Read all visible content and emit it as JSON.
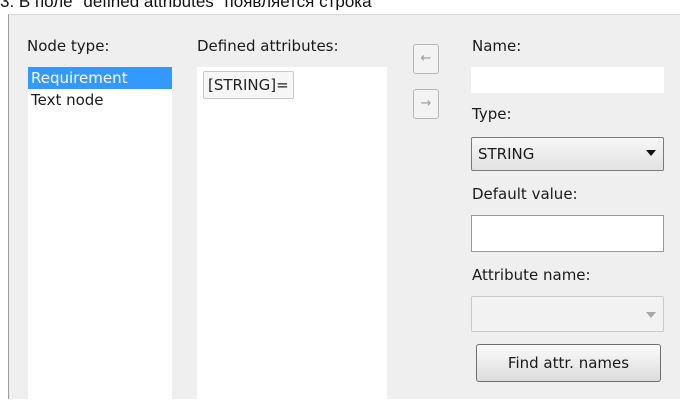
{
  "caption": "3. В поле \"defined attributes\" появляется строка",
  "node_type": {
    "label": "Node type:",
    "items": [
      "Requirement",
      "Text node"
    ],
    "selected_index": 0
  },
  "defined_attributes": {
    "label": "Defined attributes:",
    "items": [
      "[STRING]="
    ]
  },
  "arrows": {
    "left_icon": "←",
    "right_icon": "→"
  },
  "name": {
    "label": "Name:",
    "value": ""
  },
  "type": {
    "label": "Type:",
    "value": "STRING"
  },
  "default_value": {
    "label": "Default value:",
    "value": ""
  },
  "attribute_name": {
    "label": "Attribute name:",
    "value": ""
  },
  "find_button": {
    "label": "Find attr. names"
  }
}
